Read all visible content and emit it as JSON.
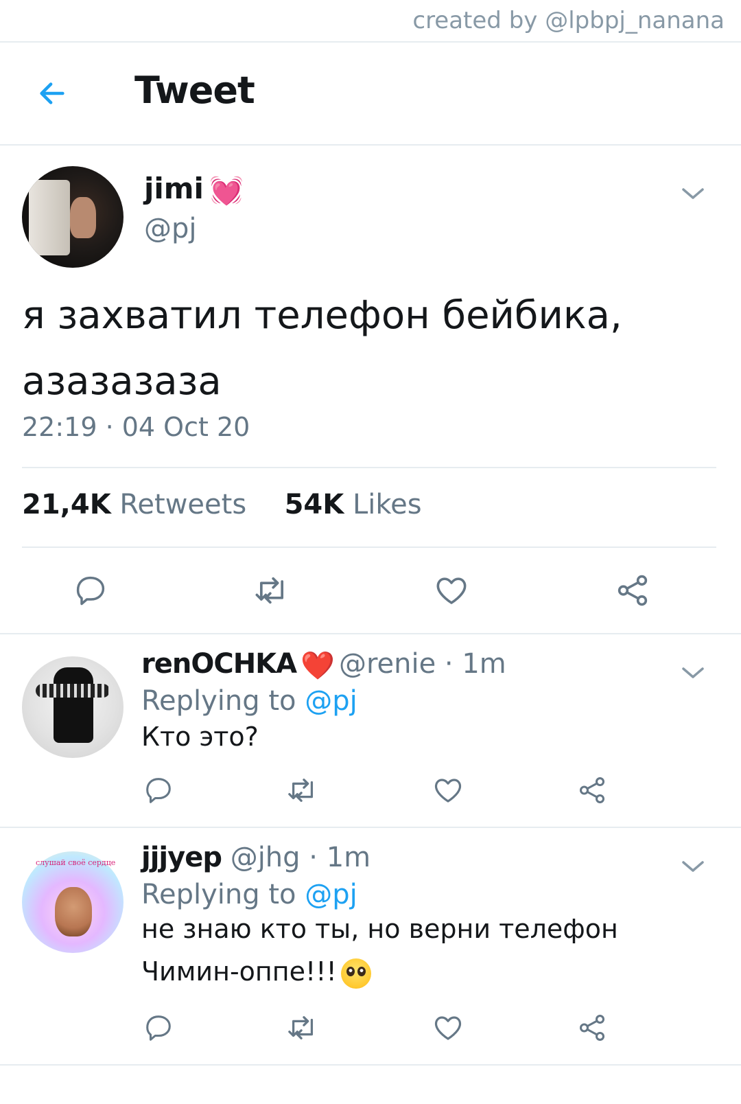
{
  "credit": "created by @lpbpj_nanana",
  "header": {
    "title": "Tweet",
    "back_icon": "arrow-left-icon",
    "accent": "#1da1f2"
  },
  "tweet": {
    "author_name": "jimi",
    "author_emoji": "💓",
    "author_handle": "@pj",
    "text_line1": "я захватил телефон бейбика,",
    "text_line2": "азазазаза",
    "timestamp": "22:19 · 04 Oct 20",
    "retweet_count": "21,4K",
    "retweet_label": "Retweets",
    "like_count": "54K",
    "like_label": "Likes"
  },
  "replies": [
    {
      "name": "renOCHKA",
      "emoji": "❤️",
      "handle": "@renie · 1m",
      "replying_prefix": "Replying to",
      "replying_mention": "@pj",
      "text": "Кто это?"
    },
    {
      "name": "jjjyep",
      "handle": "@jhg · 1m",
      "replying_prefix": "Replying to",
      "replying_mention": "@pj",
      "text_line1": "не знаю кто ты, но верни телефон",
      "text_line2": "Чимин-оппе!!!",
      "avatar_caption": "слушай своё сердце"
    }
  ],
  "colors": {
    "text": "#14171a",
    "muted": "#657786",
    "link": "#1da1f2",
    "border": "#e6ecf0"
  }
}
